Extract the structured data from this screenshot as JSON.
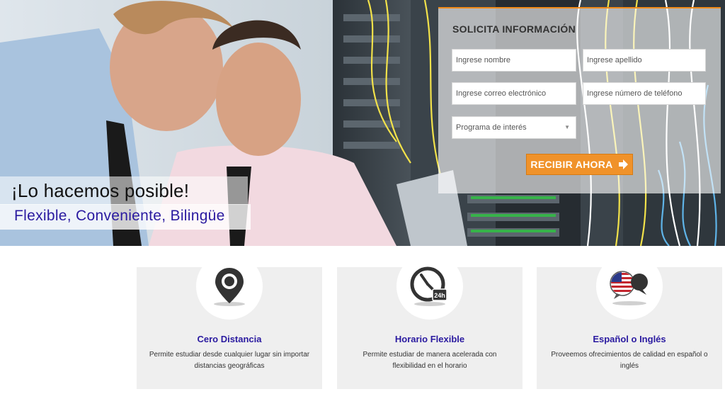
{
  "hero": {
    "tagline_primary": "¡Lo hacemos posible!",
    "tagline_secondary": "Flexible, Conveniente, Bilingüe"
  },
  "form": {
    "title": "SOLICITA INFORMACIÓN",
    "first_name_placeholder": "Ingrese nombre",
    "last_name_placeholder": "Ingrese apellido",
    "email_placeholder": "Ingrese correo electrónico",
    "phone_placeholder": "Ingrese número de teléfono",
    "program_select_value": "Programa de interés",
    "submit_label": "RECIBIR AHORA",
    "accent_color": "#f0922a"
  },
  "features": [
    {
      "icon": "location-pin-icon",
      "title": "Cero Distancia",
      "description": "Permite estudiar desde cualquier lugar sin importar distancias geográficas"
    },
    {
      "icon": "clock-24h-icon",
      "title": "Horario Flexible",
      "description": "Permite estudiar de manera acelerada con flexibilidad en el horario"
    },
    {
      "icon": "language-bubbles-icon",
      "title": "Español o Inglés",
      "description": "Proveemos ofrecimientos de calidad en español o inglés"
    }
  ],
  "colors": {
    "heading_blue": "#2a1aa0",
    "card_bg": "#efefef"
  }
}
